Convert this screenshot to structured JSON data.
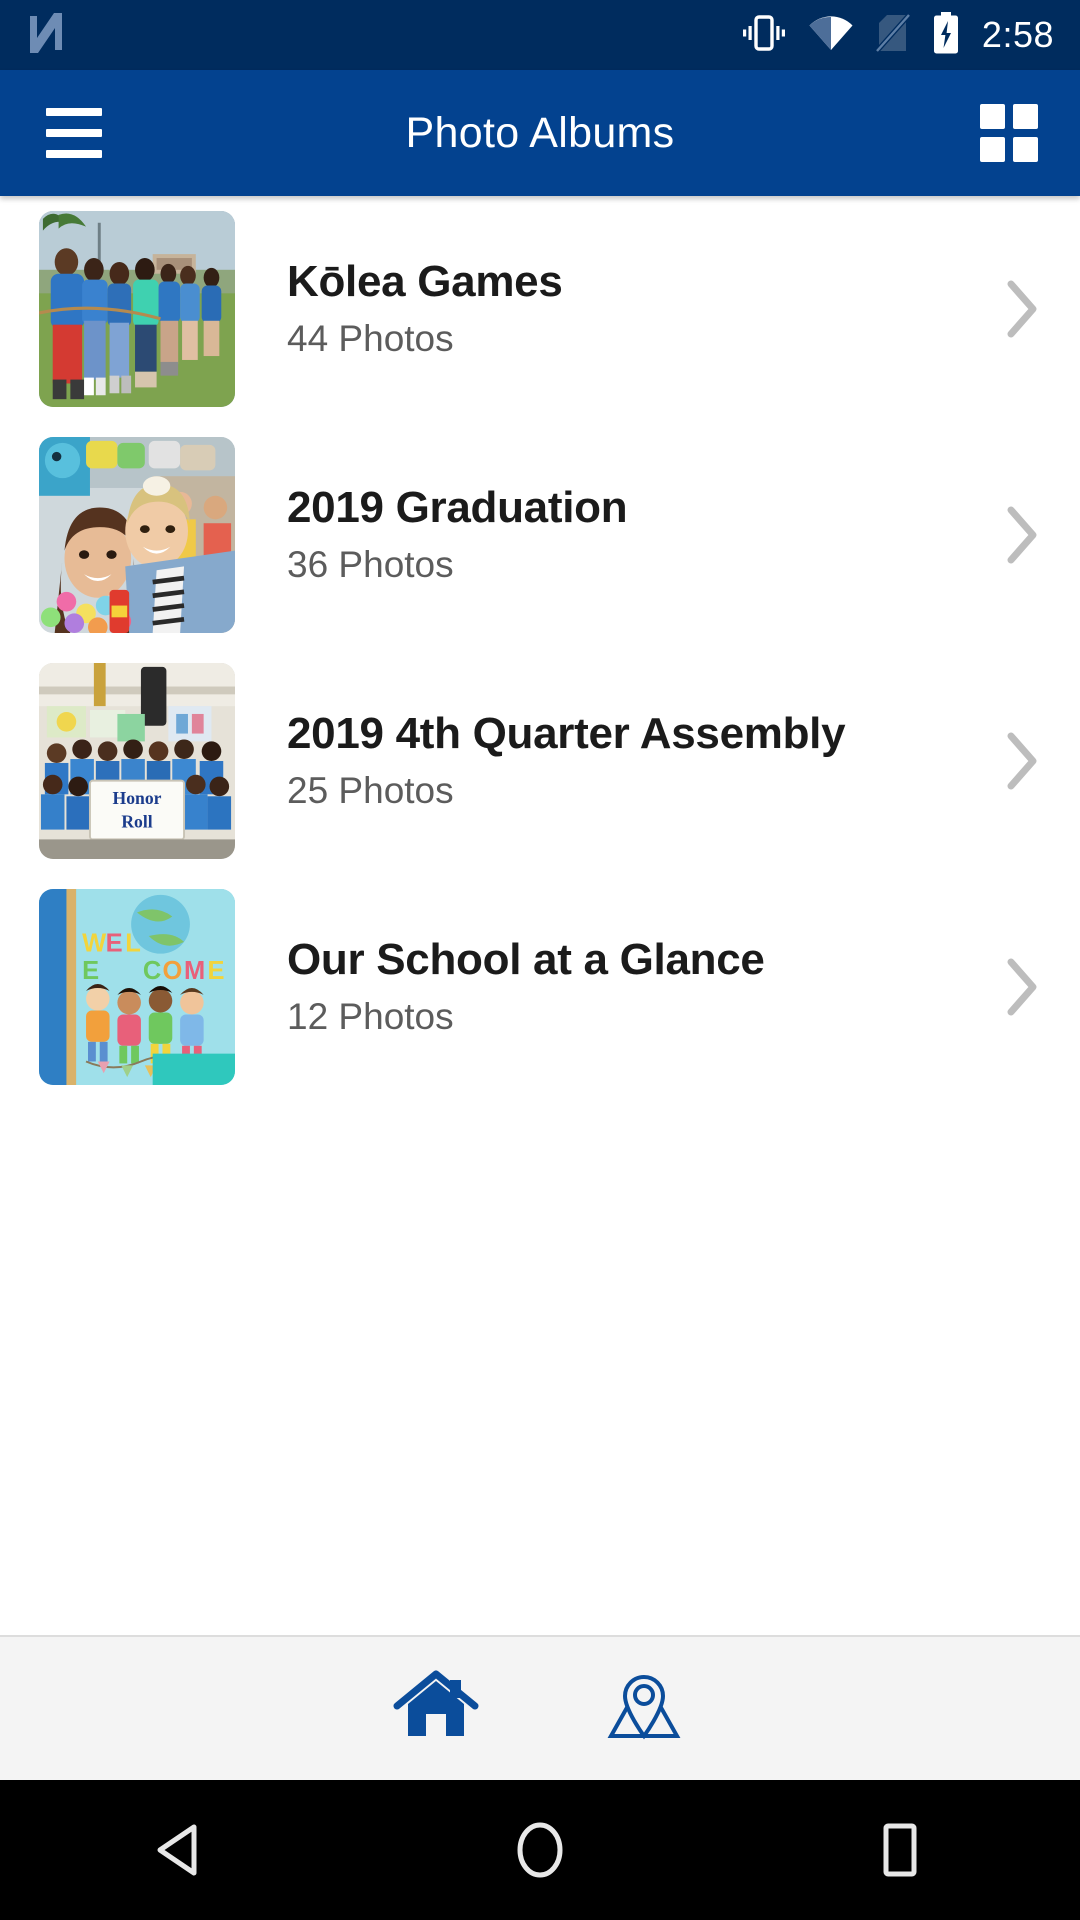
{
  "status_bar": {
    "app_logo": "nougat-n-logo",
    "icons": [
      "vibrate-icon",
      "wifi-icon",
      "no-sim-icon",
      "battery-charging-icon"
    ],
    "time": "2:58",
    "background_color": "#002C5E"
  },
  "app_bar": {
    "menu_icon": "hamburger-menu-icon",
    "title": "Photo Albums",
    "grid_icon": "grid-view-icon",
    "background_color": "#03428F",
    "text_color": "#FFFFFF"
  },
  "albums": [
    {
      "title": "Kōlea Games",
      "count": "44 Photos",
      "thumbnail": "students-tug-of-war-on-grass",
      "chevron": "chevron-right-icon"
    },
    {
      "title": "2019 Graduation",
      "count": "36 Photos",
      "thumbnail": "two-girls-with-leis-smiling",
      "chevron": "chevron-right-icon"
    },
    {
      "title": "2019 4th Quarter Assembly",
      "count": "25 Photos",
      "thumbnail": "students-holding-honor-roll-banner",
      "chevron": "chevron-right-icon"
    },
    {
      "title": "Our School at a Glance",
      "count": "12 Photos",
      "thumbnail": "welcome-mural-with-children",
      "chevron": "chevron-right-icon"
    }
  ],
  "tab_bar": {
    "background_color": "#F4F4F4",
    "accent_color": "#0B4D9B",
    "tabs": [
      {
        "icon": "home-icon",
        "selected": true
      },
      {
        "icon": "map-pin-icon",
        "selected": false
      }
    ]
  },
  "nav_bar": {
    "background_color": "#000000",
    "buttons": [
      {
        "icon": "back-triangle-icon"
      },
      {
        "icon": "home-circle-icon"
      },
      {
        "icon": "recents-square-icon"
      }
    ]
  }
}
